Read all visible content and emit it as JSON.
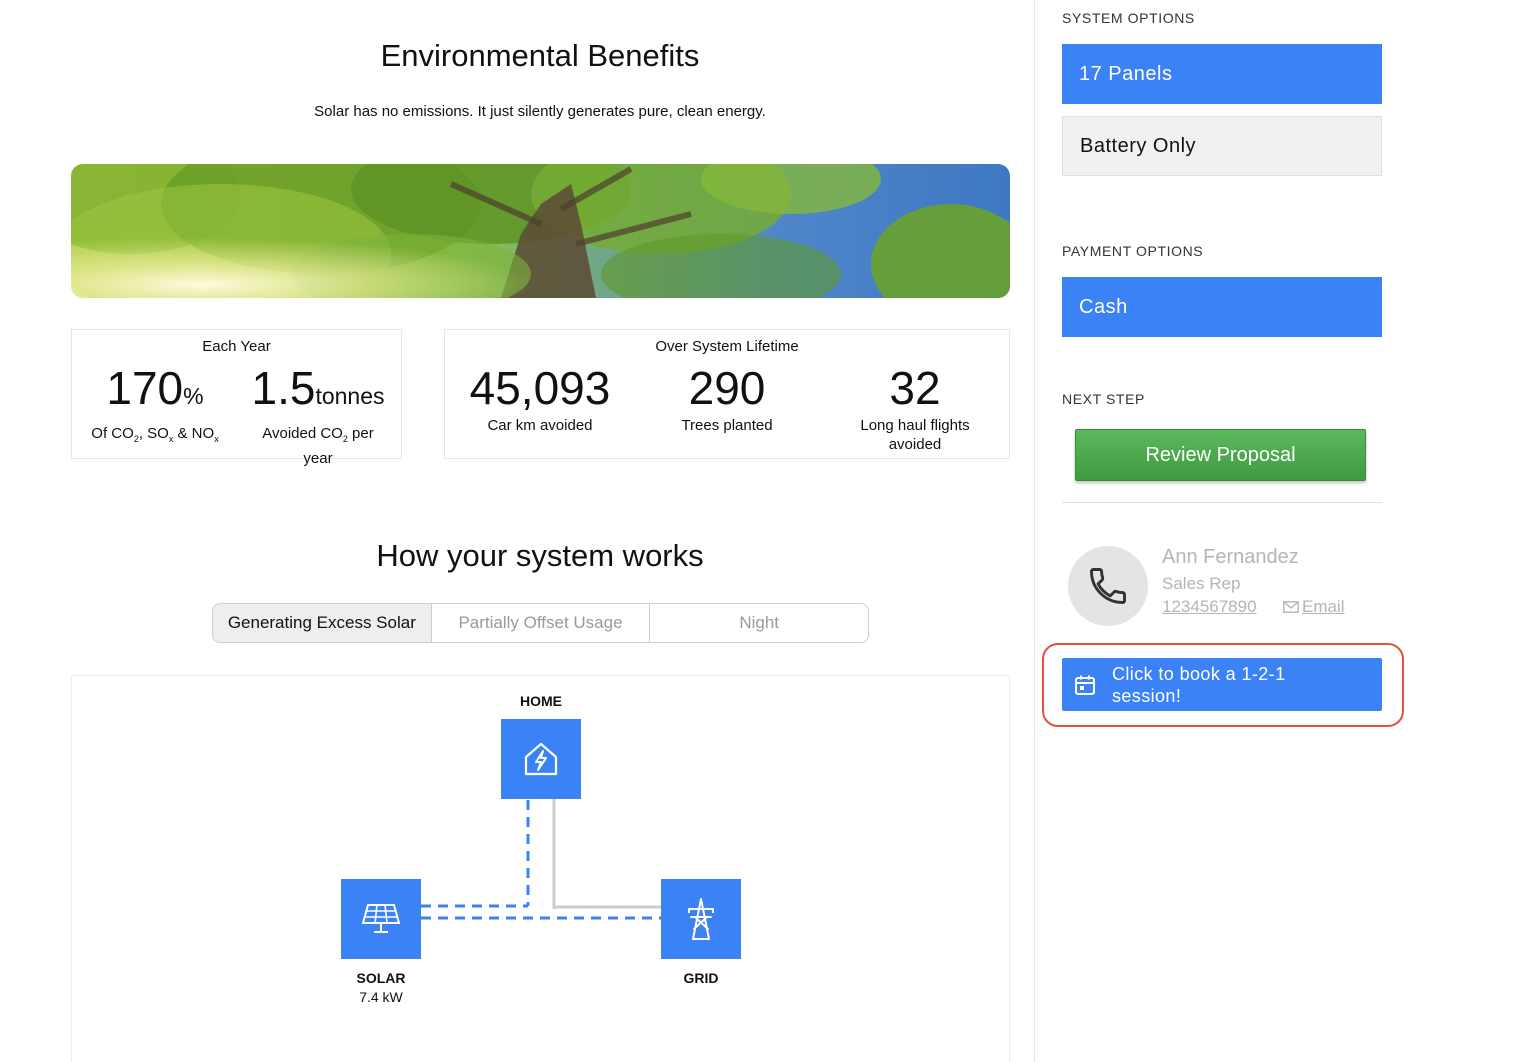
{
  "environment": {
    "title": "Environmental Benefits",
    "subtitle": "Solar has no emissions. It just silently generates pure, clean energy."
  },
  "each_year": {
    "heading": "Each Year",
    "stat1": {
      "value": "170",
      "unit": "%",
      "label_parts": [
        "Of CO",
        "2",
        ", SO",
        "x",
        " & NO",
        "x"
      ]
    },
    "stat2": {
      "value": "1.5",
      "unit": "tonnes",
      "label_parts": [
        "Avoided CO",
        "2",
        " per year"
      ]
    }
  },
  "lifetime": {
    "heading": "Over System Lifetime",
    "stats": [
      {
        "value": "45,093",
        "label": "Car km avoided"
      },
      {
        "value": "290",
        "label": "Trees planted"
      },
      {
        "value": "32",
        "label": "Long haul flights avoided"
      }
    ]
  },
  "how_it_works": {
    "title": "How your system works",
    "tabs": [
      {
        "label": "Generating Excess Solar",
        "active": true
      },
      {
        "label": "Partially Offset Usage",
        "active": false
      },
      {
        "label": "Night",
        "active": false
      }
    ],
    "nodes": {
      "home": {
        "label": "HOME",
        "icon": "home-lightning-icon"
      },
      "solar": {
        "label": "SOLAR",
        "sub": "7.4 kW",
        "icon": "solar-panel-icon"
      },
      "grid": {
        "label": "GRID",
        "icon": "power-tower-icon"
      }
    }
  },
  "sidebar": {
    "system_options": {
      "heading": "SYSTEM OPTIONS",
      "options": [
        {
          "label": "17 Panels",
          "selected": true
        },
        {
          "label": "Battery Only",
          "selected": false
        }
      ]
    },
    "payment_options": {
      "heading": "PAYMENT OPTIONS",
      "options": [
        {
          "label": "Cash",
          "selected": true
        }
      ]
    },
    "next_step": {
      "heading": "NEXT STEP",
      "button": "Review Proposal"
    },
    "rep": {
      "name": "Ann Fernandez",
      "role": "Sales Rep",
      "phone": "1234567890",
      "email_label": "Email"
    },
    "book_button": "Click to book a 1-2-1 session!"
  },
  "colors": {
    "accent_blue": "#3b82f6",
    "review_green": "#4caf50",
    "highlight_outline": "#e0533a"
  }
}
